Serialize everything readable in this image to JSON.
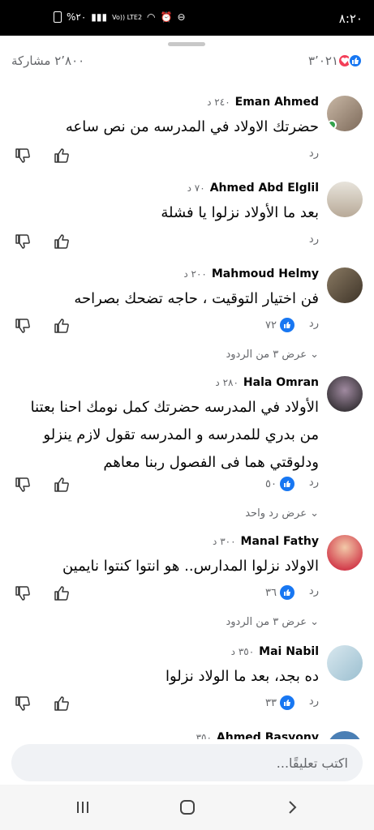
{
  "status_bar": {
    "time": "٨:٢٠",
    "battery": "%٢٠",
    "network": "Vo)) LTE2"
  },
  "header": {
    "reaction_count": "٣٬٠٢١",
    "shares": "٢٬٨٠٠ مشاركة"
  },
  "labels": {
    "reply": "رد"
  },
  "comments": [
    {
      "name": "Eman Ahmed",
      "time": "٢٤٠ د",
      "text": "حضرتك الاولاد في المدرسه من نص ساعه",
      "likes": "",
      "view_replies": ""
    },
    {
      "name": "Ahmed Abd Elglil",
      "time": "٧٠ د",
      "text": "بعد ما الأولاد نزلوا يا فشلة",
      "likes": "",
      "view_replies": ""
    },
    {
      "name": "Mahmoud Helmy",
      "time": "٢٠٠ د",
      "text": "فن اختيار التوقيت ، حاجه تضحك بصراحه",
      "likes": "٧٢",
      "view_replies": "عرض ٣ من الردود"
    },
    {
      "name": "Hala Omran",
      "time": "٢٨٠ د",
      "text": "الأولاد في المدرسه حضرتك كمل نومك احنا بعتنا من بدري للمدرسه و المدرسه تقول لازم ينزلو ودلوقتي هما فى الفصول ربنا معاهم",
      "likes": "٥٠",
      "view_replies": "عرض رد واحد"
    },
    {
      "name": "Manal Fathy",
      "time": "٣٠٠ د",
      "text": "الاولاد نزلوا المدارس..  هو انتوا كنتوا نايمين",
      "likes": "٣٦",
      "view_replies": "عرض ٣ من الردود"
    },
    {
      "name": "Mai Nabil",
      "time": "٣٥٠ د",
      "text": "ده بجد، بعد ما الولاد نزلوا",
      "likes": "٣٣",
      "view_replies": ""
    },
    {
      "name": "Ahmed Basyony",
      "time": "٣٥٠",
      "text": "",
      "likes": "",
      "view_replies": ""
    }
  ],
  "composer": {
    "placeholder": "اكتب تعليقًا..."
  },
  "colors": {
    "accent": "#1877f2",
    "love": "#f33e58",
    "secondary_text": "#65676b",
    "online": "#31a24c"
  }
}
